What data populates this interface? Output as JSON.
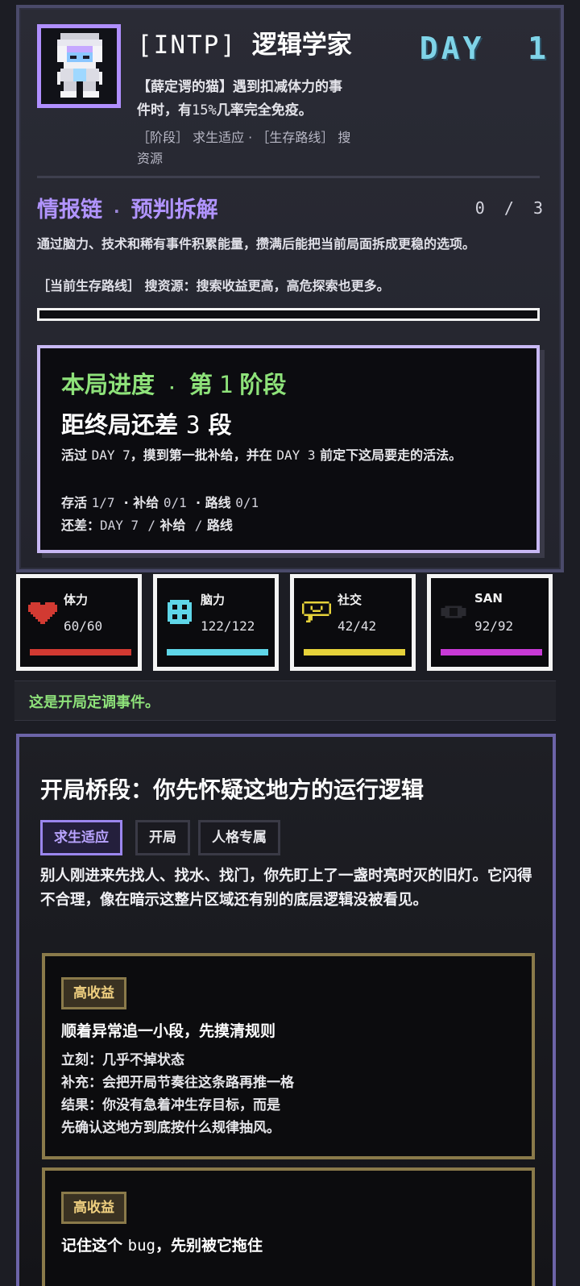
{
  "character": {
    "mbti": "[INTP]",
    "name": "逻辑学家",
    "trait_line1": "【薛定谔的猫】遇到扣减体力的事",
    "trait_line2_a": "件时，有",
    "trait_line2_pct": "15%",
    "trait_line2_b": "几率完全免疫。",
    "meta_line1": "［阶段］ 求生适应 · ［生存路线］ 搜",
    "meta_line2": "资源"
  },
  "day": {
    "label": "DAY",
    "value": "1"
  },
  "intel_chain": {
    "title": "情报链",
    "subtitle": "预判拆解",
    "count": "0 / 3",
    "progress": 0,
    "desc": "通过脑力、技术和稀有事件积累能量，攒满后能把当前局面拆成更稳的选项。",
    "route": "［当前生存路线］ 搜资源：搜索收益更高，高危探索也更多。"
  },
  "run_progress": {
    "stage_label": "本局进度",
    "stage_prefix": "第",
    "stage_num": "1",
    "stage_suffix": "阶段",
    "remain_prefix": "距终局还差",
    "remain_num": "3",
    "remain_suffix": "段",
    "desc_a": "活过 ",
    "desc_day7": "DAY 7",
    "desc_b": "，摸到第一批补给，并在 ",
    "desc_day3": "DAY 3",
    "desc_c": " 前定下这局要走的活法。",
    "survive_label": "存活",
    "survive_val": "1/7",
    "supply_label": "补给",
    "supply_val": "0/1",
    "route_label": "路线",
    "route_val": "0/1",
    "gap_label": "还差：",
    "gap_day": "DAY 7",
    "gap_sep": "/",
    "gap_supply": "补给",
    "gap_route": "路线"
  },
  "stats": [
    {
      "name": "体力",
      "value": "60/60",
      "icon": "heart-icon",
      "color": "#d23a32",
      "fraction": 1.0
    },
    {
      "name": "脑力",
      "value": "122/122",
      "icon": "brain-icon",
      "color": "#5fd6e8",
      "fraction": 1.0
    },
    {
      "name": "社交",
      "value": "42/42",
      "icon": "chat-icon",
      "color": "#e6d23a",
      "fraction": 1.0
    },
    {
      "name": "SAN",
      "value": "92/92",
      "icon": "eye-icon",
      "color": "#c83ad6",
      "fraction": 1.0
    }
  ],
  "hint": "这是开局定调事件。",
  "event": {
    "title": "开局桥段：你先怀疑这地方的运行逻辑",
    "tags": [
      "求生适应",
      "开局",
      "人格专属"
    ],
    "body": "别人刚进来先找人、找水、找门，你先盯上了一盏时亮时灭的旧灯。它闪得不合理，像在暗示这整片区域还有别的底层逻辑没被看见。",
    "choices": [
      {
        "badge": "高收益",
        "title": "顺着异常追一小段，先摸清规则",
        "line1": "立刻：几乎不掉状态",
        "line2": "补充：会把开局节奏往这条路再推一格",
        "line3": "结果：你没有急着冲生存目标，而是",
        "line4": "先确认这地方到底按什么规律抽风。"
      },
      {
        "badge": "高收益",
        "title_a": "记住这个 ",
        "title_code": "bug",
        "title_b": "，先别被它拖住"
      }
    ]
  }
}
